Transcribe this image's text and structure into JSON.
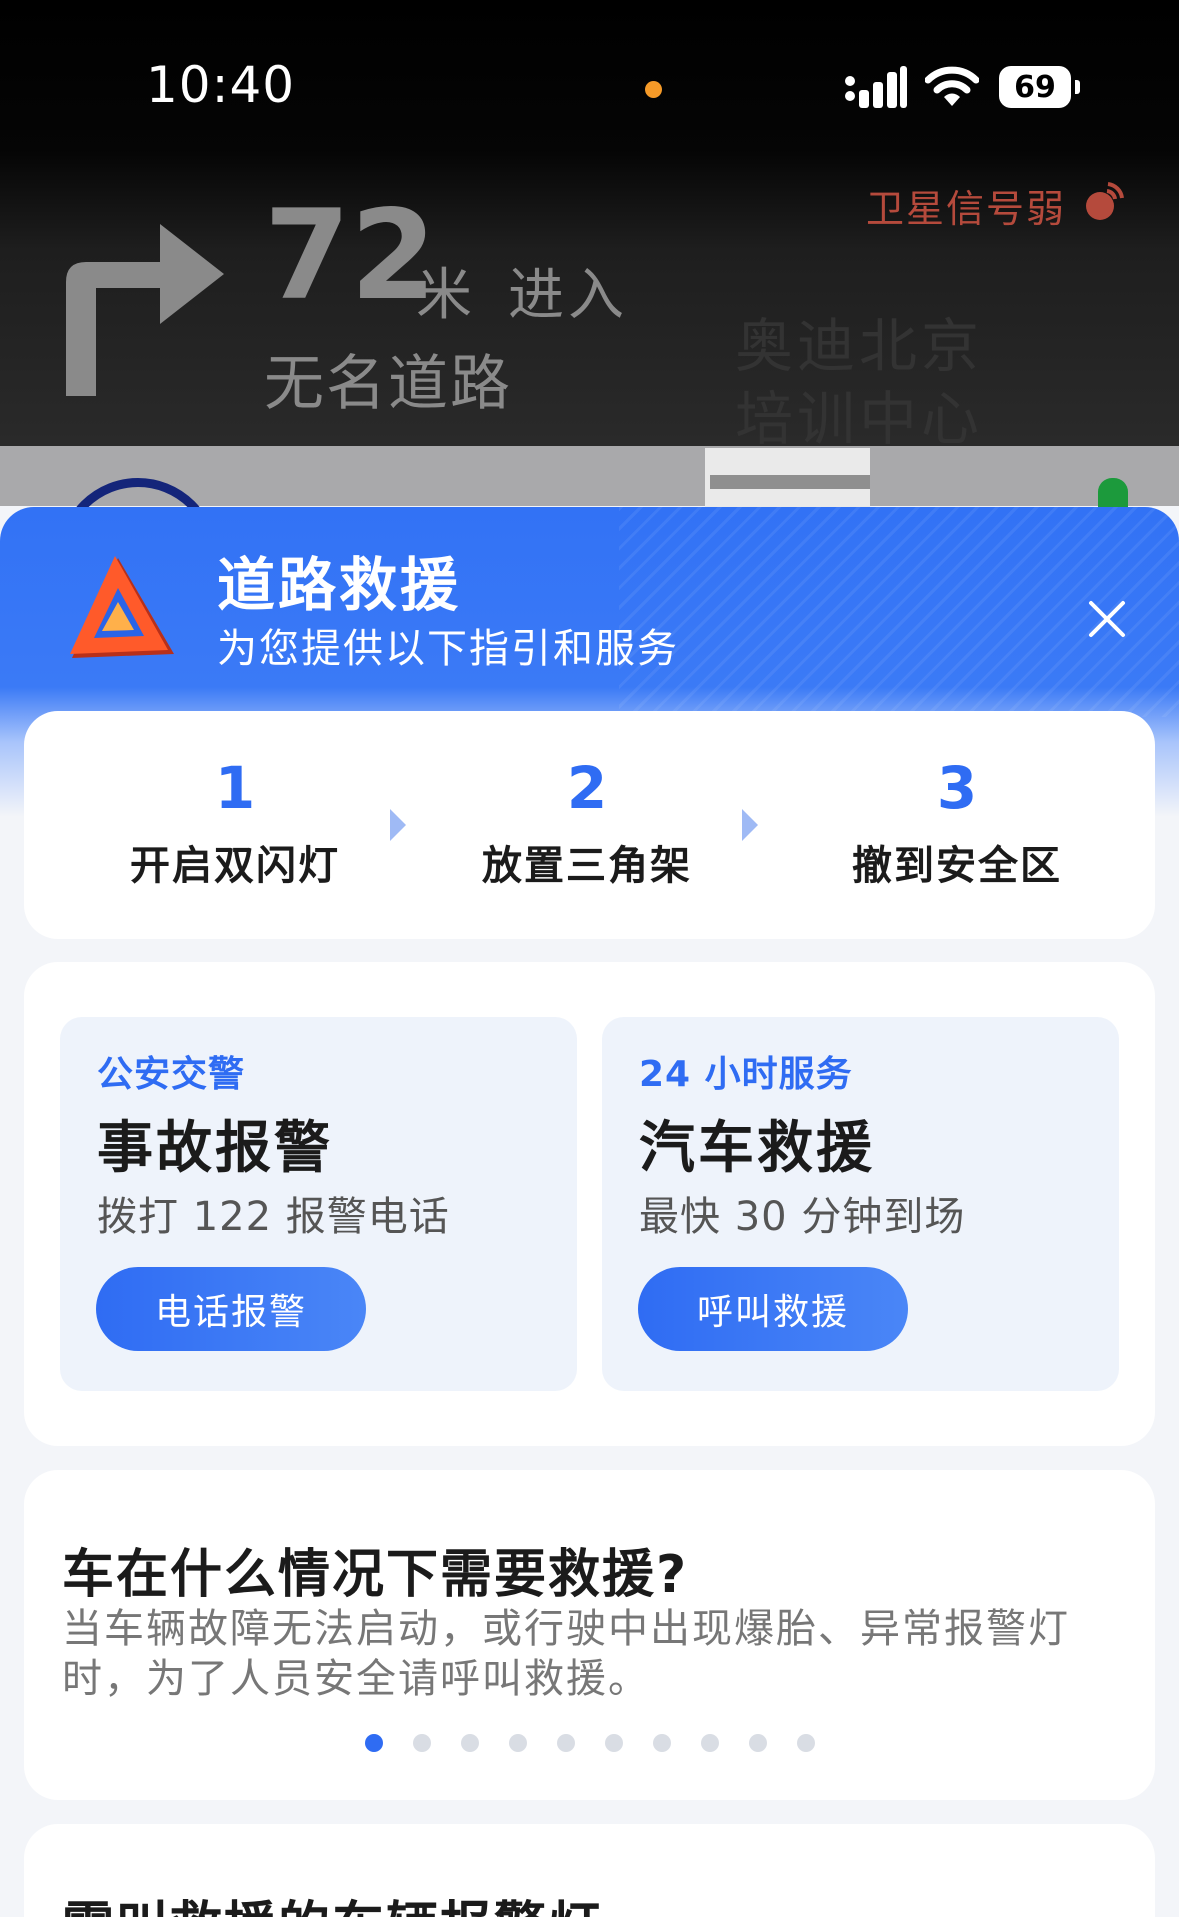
{
  "status_bar": {
    "time": "10:40",
    "battery": "69",
    "dot_color": "#f59a28"
  },
  "navigation": {
    "gps_warning": "卫星信号弱",
    "distance": "72",
    "distance_unit": "米",
    "action": "进入",
    "road": "无名道路",
    "map_label_line1": "奥迪北京",
    "map_label_line2": "培训中心"
  },
  "rescue": {
    "title": "道路救援",
    "subtitle": "为您提供以下指引和服务",
    "accent_color": "#2f6cf3",
    "icons": {
      "warning": "warning-triangle-icon",
      "close": "close-icon"
    }
  },
  "steps": [
    {
      "num": "1",
      "label": "开启双闪灯"
    },
    {
      "num": "2",
      "label": "放置三角架"
    },
    {
      "num": "3",
      "label": "撤到安全区"
    }
  ],
  "services": [
    {
      "tag": "公安交警",
      "title": "事故报警",
      "desc": "拨打 122 报警电话",
      "button": "电话报警"
    },
    {
      "tag": "24 小时服务",
      "title": "汽车救援",
      "desc": "最快 30 分钟到场",
      "button": "呼叫救援"
    }
  ],
  "info": {
    "title": "车在什么情况下需要救援?",
    "text": "当车辆故障无法启动，或行驶中出现爆胎、异常报警灯时，为了人员安全请呼叫救援。",
    "page_count": 10,
    "active_page": 1
  },
  "next_section": {
    "title": "需叫救援的车辆报警灯"
  }
}
